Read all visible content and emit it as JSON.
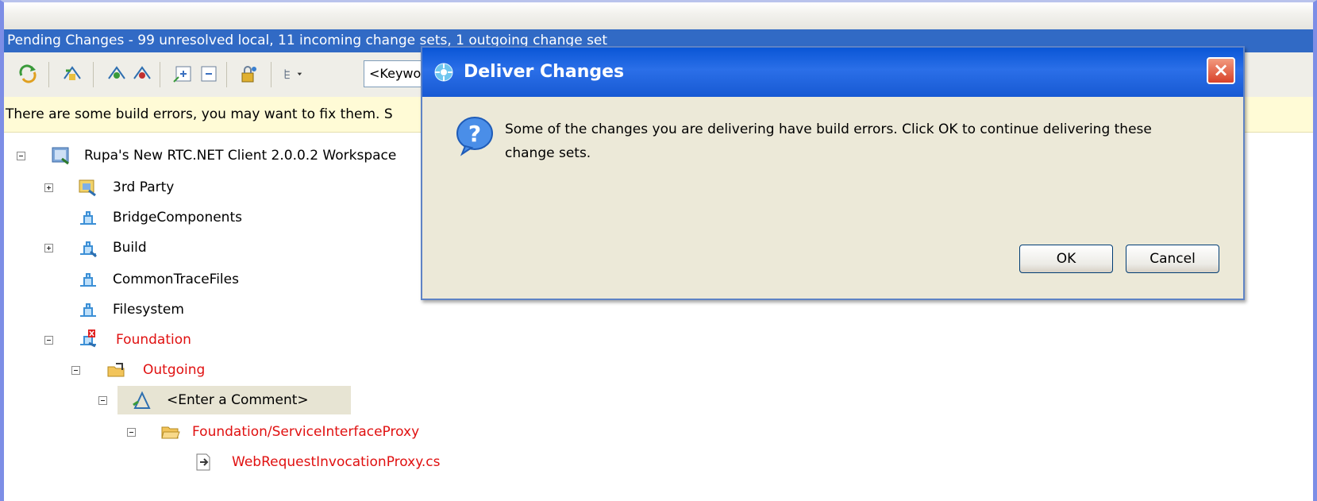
{
  "panel": {
    "title": "Pending Changes - 99 unresolved local, 11 incoming change sets, 1 outgoing change set",
    "filter_placeholder": "<Keywo",
    "warning": "There are some build errors, you may want to fix them. S"
  },
  "tree": {
    "workspace": "Rupa's New RTC.NET Client 2.0.0.2 Workspace",
    "items": [
      {
        "label": "3rd Party"
      },
      {
        "label": "BridgeComponents"
      },
      {
        "label": "Build"
      },
      {
        "label": "CommonTraceFiles"
      },
      {
        "label": "Filesystem"
      },
      {
        "label": "Foundation"
      },
      {
        "label": "Outgoing"
      },
      {
        "label": "<Enter a Comment>"
      },
      {
        "label": "Foundation/ServiceInterfaceProxy"
      },
      {
        "label": "WebRequestInvocationProxy.cs"
      }
    ]
  },
  "dialog": {
    "title": "Deliver Changes",
    "message": "Some of the changes you are delivering have build errors. Click OK to continue delivering these change sets.",
    "ok_label": "OK",
    "cancel_label": "Cancel"
  },
  "colors": {
    "title_bar": "#316ac5",
    "error_text": "#e01010",
    "dialog_title": "#0a56d6",
    "warning_bg": "#fffbd6"
  }
}
